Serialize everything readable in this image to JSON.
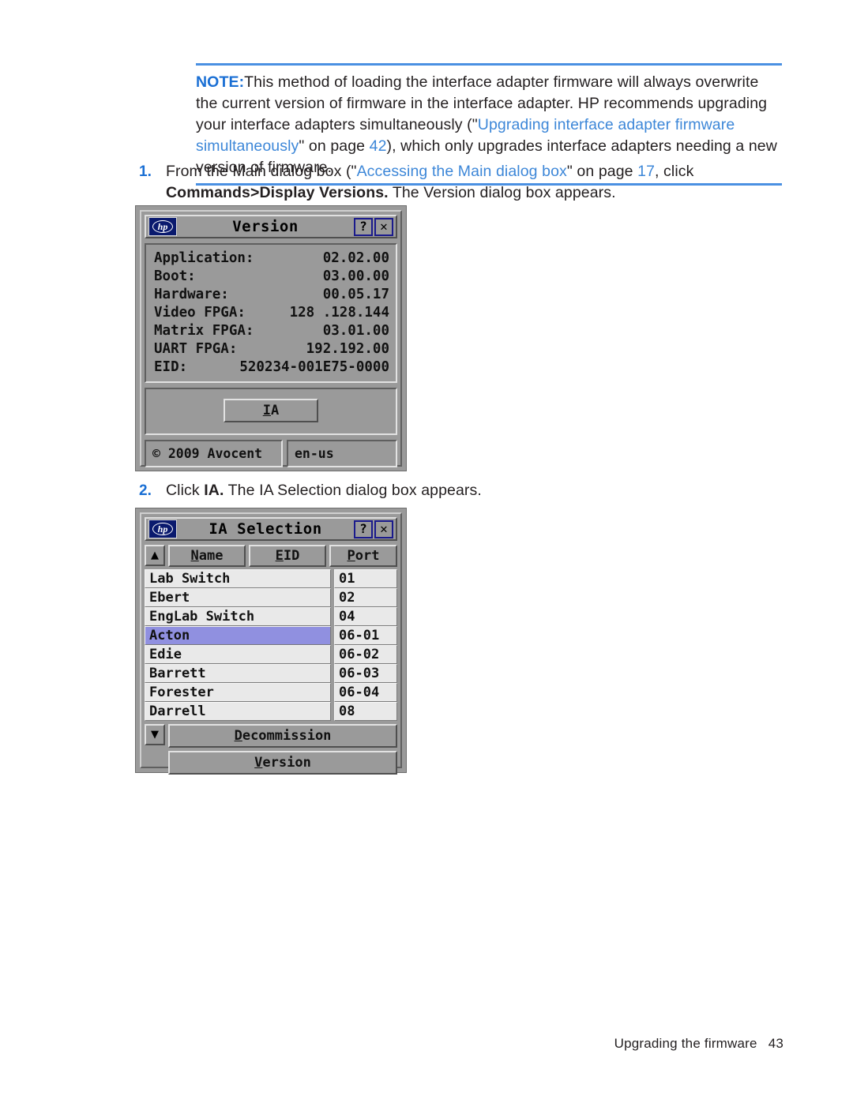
{
  "note": {
    "label": "NOTE:",
    "text_part_1": "This method of loading the interface adapter firmware will always overwrite the current version of firmware in the interface adapter. HP recommends upgrading your interface adapters simultaneously (\"",
    "link_text": "Upgrading interface adapter firmware simultaneously",
    "text_part_2": "\" on page ",
    "page_ref": "42",
    "text_part_3": "), which only upgrades interface adapters needing a new version of firmware."
  },
  "steps": [
    {
      "number": "1.",
      "text_part_1": "From the Main dialog box (\"",
      "link_text": "Accessing the Main dialog box",
      "text_part_2": "\" on page ",
      "page_ref": "17",
      "text_part_3": ", click ",
      "bold_text": "Commands>Display Versions.",
      "text_part_4": " The Version dialog box appears."
    },
    {
      "number": "2.",
      "text_part_1": "Click ",
      "bold_text": "IA.",
      "text_part_2": " The IA Selection dialog box appears."
    }
  ],
  "version_dialog": {
    "title": "Version",
    "logo_text": "hp",
    "help_button": "?",
    "close_button": "✕",
    "fields": [
      {
        "label": "Application:",
        "value": "02.02.00"
      },
      {
        "label": "Boot:",
        "value": "03.00.00"
      },
      {
        "label": "Hardware:",
        "value": "00.05.17"
      },
      {
        "label": "Video FPGA:",
        "value": "128 .128.144"
      },
      {
        "label": "Matrix FPGA:",
        "value": "03.01.00"
      },
      {
        "label": "UART FPGA:",
        "value": "192.192.00"
      },
      {
        "label": "EID:",
        "value": "520234-001E75-0000"
      }
    ],
    "ia_button": {
      "accel": "I",
      "rest": "A"
    },
    "copyright": "© 2009 Avocent",
    "locale": "en-us"
  },
  "ia_selection_dialog": {
    "title": "IA Selection",
    "logo_text": "hp",
    "help_button": "?",
    "close_button": "✕",
    "scroll_up_icon": "▲",
    "scroll_down_icon": "▼",
    "columns": [
      {
        "accel": "N",
        "rest": "ame"
      },
      {
        "accel": "E",
        "rest": "ID"
      },
      {
        "accel": "P",
        "rest": "ort"
      }
    ],
    "rows": [
      {
        "name": "Lab Switch",
        "eid": "",
        "port": "01",
        "selected": false
      },
      {
        "name": "Ebert",
        "eid": "",
        "port": "02",
        "selected": false
      },
      {
        "name": "EngLab Switch",
        "eid": "",
        "port": "04",
        "selected": false
      },
      {
        "name": "Acton",
        "eid": "",
        "port": "06-01",
        "selected": true
      },
      {
        "name": "Edie",
        "eid": "",
        "port": "06-02",
        "selected": false
      },
      {
        "name": "Barrett",
        "eid": "",
        "port": "06-03",
        "selected": false
      },
      {
        "name": "Forester",
        "eid": "",
        "port": "06-04",
        "selected": false
      },
      {
        "name": "Darrell",
        "eid": "",
        "port": "08",
        "selected": false
      }
    ],
    "buttons": [
      {
        "accel": "D",
        "rest": "ecommission"
      },
      {
        "accel": "V",
        "rest": "ersion"
      }
    ]
  },
  "footer": {
    "text": "Upgrading the firmware",
    "page_number": "43"
  },
  "colors": {
    "link": "#3d87d8",
    "note_label": "#1a6fd4",
    "rule": "#4a90e2",
    "selection": "#9090e0",
    "dialog_face": "#9a9a9a",
    "hp_blue": "#0a1a6e"
  }
}
